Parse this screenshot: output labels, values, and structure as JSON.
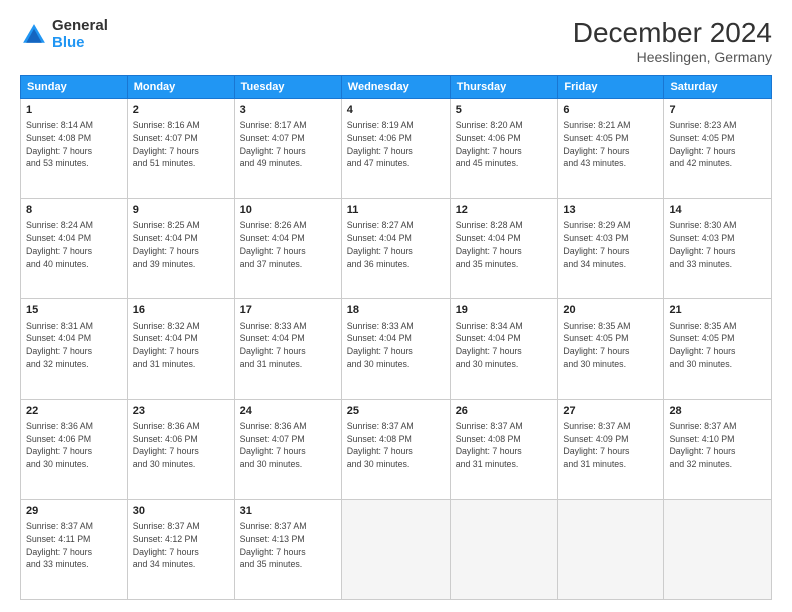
{
  "logo": {
    "text_general": "General",
    "text_blue": "Blue"
  },
  "header": {
    "title": "December 2024",
    "subtitle": "Heeslingen, Germany"
  },
  "calendar": {
    "days_of_week": [
      "Sunday",
      "Monday",
      "Tuesday",
      "Wednesday",
      "Thursday",
      "Friday",
      "Saturday"
    ],
    "weeks": [
      [
        {
          "day": "1",
          "info": "Sunrise: 8:14 AM\nSunset: 4:08 PM\nDaylight: 7 hours\nand 53 minutes."
        },
        {
          "day": "2",
          "info": "Sunrise: 8:16 AM\nSunset: 4:07 PM\nDaylight: 7 hours\nand 51 minutes."
        },
        {
          "day": "3",
          "info": "Sunrise: 8:17 AM\nSunset: 4:07 PM\nDaylight: 7 hours\nand 49 minutes."
        },
        {
          "day": "4",
          "info": "Sunrise: 8:19 AM\nSunset: 4:06 PM\nDaylight: 7 hours\nand 47 minutes."
        },
        {
          "day": "5",
          "info": "Sunrise: 8:20 AM\nSunset: 4:06 PM\nDaylight: 7 hours\nand 45 minutes."
        },
        {
          "day": "6",
          "info": "Sunrise: 8:21 AM\nSunset: 4:05 PM\nDaylight: 7 hours\nand 43 minutes."
        },
        {
          "day": "7",
          "info": "Sunrise: 8:23 AM\nSunset: 4:05 PM\nDaylight: 7 hours\nand 42 minutes."
        }
      ],
      [
        {
          "day": "8",
          "info": "Sunrise: 8:24 AM\nSunset: 4:04 PM\nDaylight: 7 hours\nand 40 minutes."
        },
        {
          "day": "9",
          "info": "Sunrise: 8:25 AM\nSunset: 4:04 PM\nDaylight: 7 hours\nand 39 minutes."
        },
        {
          "day": "10",
          "info": "Sunrise: 8:26 AM\nSunset: 4:04 PM\nDaylight: 7 hours\nand 37 minutes."
        },
        {
          "day": "11",
          "info": "Sunrise: 8:27 AM\nSunset: 4:04 PM\nDaylight: 7 hours\nand 36 minutes."
        },
        {
          "day": "12",
          "info": "Sunrise: 8:28 AM\nSunset: 4:04 PM\nDaylight: 7 hours\nand 35 minutes."
        },
        {
          "day": "13",
          "info": "Sunrise: 8:29 AM\nSunset: 4:03 PM\nDaylight: 7 hours\nand 34 minutes."
        },
        {
          "day": "14",
          "info": "Sunrise: 8:30 AM\nSunset: 4:03 PM\nDaylight: 7 hours\nand 33 minutes."
        }
      ],
      [
        {
          "day": "15",
          "info": "Sunrise: 8:31 AM\nSunset: 4:04 PM\nDaylight: 7 hours\nand 32 minutes."
        },
        {
          "day": "16",
          "info": "Sunrise: 8:32 AM\nSunset: 4:04 PM\nDaylight: 7 hours\nand 31 minutes."
        },
        {
          "day": "17",
          "info": "Sunrise: 8:33 AM\nSunset: 4:04 PM\nDaylight: 7 hours\nand 31 minutes."
        },
        {
          "day": "18",
          "info": "Sunrise: 8:33 AM\nSunset: 4:04 PM\nDaylight: 7 hours\nand 30 minutes."
        },
        {
          "day": "19",
          "info": "Sunrise: 8:34 AM\nSunset: 4:04 PM\nDaylight: 7 hours\nand 30 minutes."
        },
        {
          "day": "20",
          "info": "Sunrise: 8:35 AM\nSunset: 4:05 PM\nDaylight: 7 hours\nand 30 minutes."
        },
        {
          "day": "21",
          "info": "Sunrise: 8:35 AM\nSunset: 4:05 PM\nDaylight: 7 hours\nand 30 minutes."
        }
      ],
      [
        {
          "day": "22",
          "info": "Sunrise: 8:36 AM\nSunset: 4:06 PM\nDaylight: 7 hours\nand 30 minutes."
        },
        {
          "day": "23",
          "info": "Sunrise: 8:36 AM\nSunset: 4:06 PM\nDaylight: 7 hours\nand 30 minutes."
        },
        {
          "day": "24",
          "info": "Sunrise: 8:36 AM\nSunset: 4:07 PM\nDaylight: 7 hours\nand 30 minutes."
        },
        {
          "day": "25",
          "info": "Sunrise: 8:37 AM\nSunset: 4:08 PM\nDaylight: 7 hours\nand 30 minutes."
        },
        {
          "day": "26",
          "info": "Sunrise: 8:37 AM\nSunset: 4:08 PM\nDaylight: 7 hours\nand 31 minutes."
        },
        {
          "day": "27",
          "info": "Sunrise: 8:37 AM\nSunset: 4:09 PM\nDaylight: 7 hours\nand 31 minutes."
        },
        {
          "day": "28",
          "info": "Sunrise: 8:37 AM\nSunset: 4:10 PM\nDaylight: 7 hours\nand 32 minutes."
        }
      ],
      [
        {
          "day": "29",
          "info": "Sunrise: 8:37 AM\nSunset: 4:11 PM\nDaylight: 7 hours\nand 33 minutes."
        },
        {
          "day": "30",
          "info": "Sunrise: 8:37 AM\nSunset: 4:12 PM\nDaylight: 7 hours\nand 34 minutes."
        },
        {
          "day": "31",
          "info": "Sunrise: 8:37 AM\nSunset: 4:13 PM\nDaylight: 7 hours\nand 35 minutes."
        },
        {
          "day": "",
          "info": ""
        },
        {
          "day": "",
          "info": ""
        },
        {
          "day": "",
          "info": ""
        },
        {
          "day": "",
          "info": ""
        }
      ]
    ]
  }
}
